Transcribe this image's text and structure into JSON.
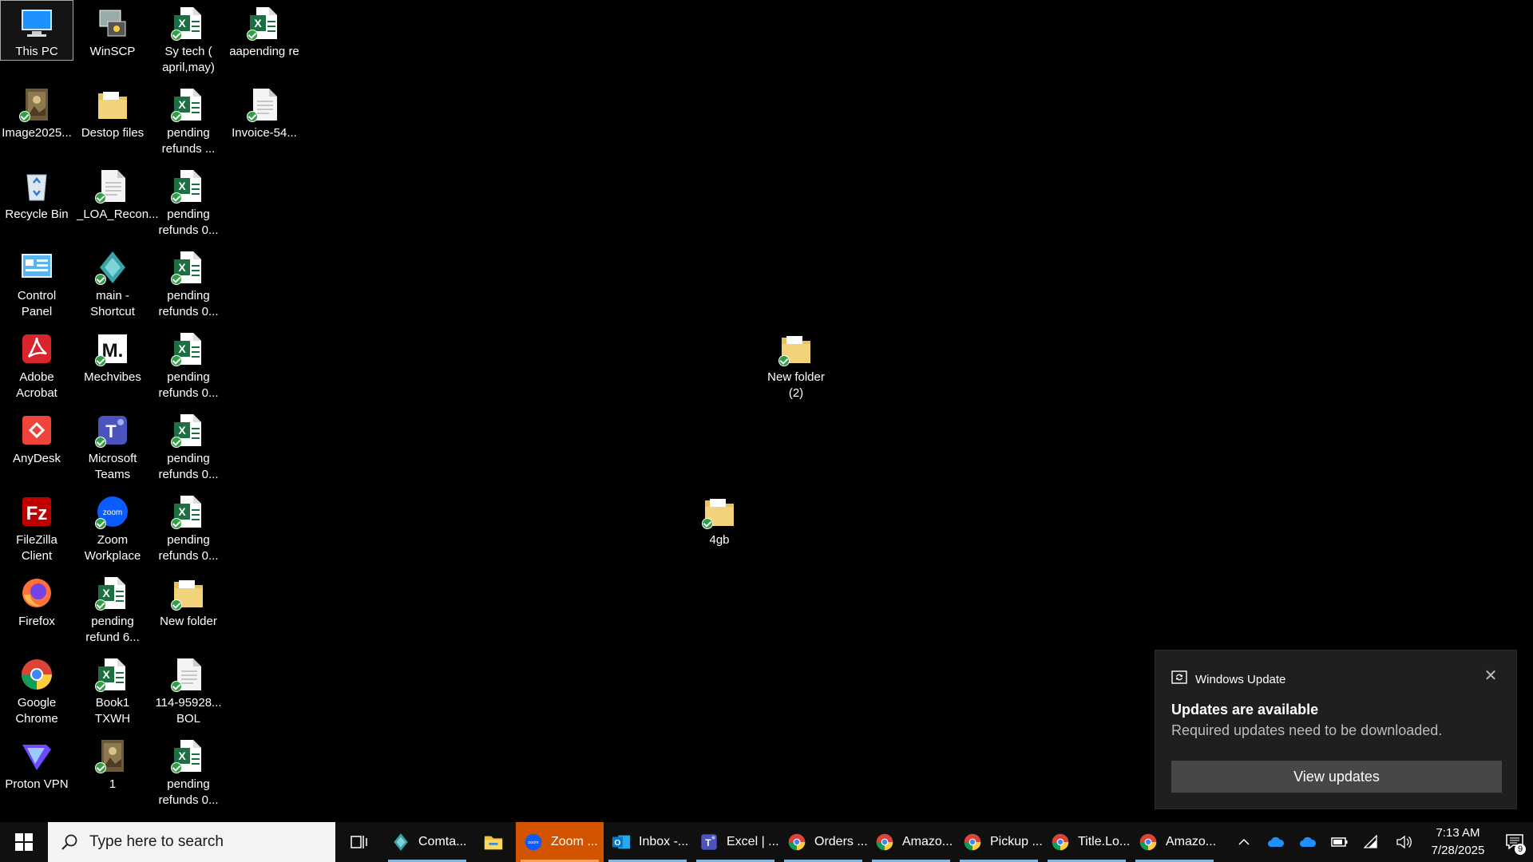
{
  "desktop": {
    "icons": [
      {
        "label": "This PC",
        "icon": "this-pc-icon",
        "col": 0,
        "row": 0,
        "selected": true,
        "synced": false
      },
      {
        "label": "WinSCP",
        "icon": "winscp-icon",
        "col": 1,
        "row": 0,
        "synced": false
      },
      {
        "label": "Sy tech (\napril,may)",
        "icon": "excel-file-icon",
        "col": 2,
        "row": 0,
        "synced": true
      },
      {
        "label": "aapending re",
        "icon": "excel-file-icon",
        "col": 3,
        "row": 0,
        "synced": true
      },
      {
        "label": "Image2025...",
        "icon": "image-file-icon",
        "col": 0,
        "row": 1,
        "synced": true
      },
      {
        "label": "Destop files",
        "icon": "folder-icon",
        "col": 1,
        "row": 1,
        "synced": false
      },
      {
        "label": "pending\nrefunds ...",
        "icon": "excel-file-icon",
        "col": 2,
        "row": 1,
        "synced": true
      },
      {
        "label": "Invoice-54...",
        "icon": "document-file-icon",
        "col": 3,
        "row": 1,
        "synced": true
      },
      {
        "label": "Recycle Bin",
        "icon": "recycle-bin-icon",
        "col": 0,
        "row": 2,
        "synced": false
      },
      {
        "label": "_LOA_Recon...",
        "icon": "document-file-icon",
        "col": 1,
        "row": 2,
        "synced": true
      },
      {
        "label": "pending\nrefunds 0...",
        "icon": "excel-file-icon",
        "col": 2,
        "row": 2,
        "synced": true
      },
      {
        "label": "Control Panel",
        "icon": "control-panel-icon",
        "col": 0,
        "row": 3,
        "synced": false
      },
      {
        "label": "main -\nShortcut",
        "icon": "shortcut-app-icon",
        "col": 1,
        "row": 3,
        "synced": true
      },
      {
        "label": "pending\nrefunds 0...",
        "icon": "excel-file-icon",
        "col": 2,
        "row": 3,
        "synced": true
      },
      {
        "label": "Adobe\nAcrobat",
        "icon": "adobe-acrobat-icon",
        "col": 0,
        "row": 4,
        "synced": false
      },
      {
        "label": "Mechvibes",
        "icon": "mechvibes-icon",
        "col": 1,
        "row": 4,
        "synced": true
      },
      {
        "label": "pending\nrefunds 0...",
        "icon": "excel-file-icon",
        "col": 2,
        "row": 4,
        "synced": true
      },
      {
        "label": "AnyDesk",
        "icon": "anydesk-icon",
        "col": 0,
        "row": 5,
        "synced": false
      },
      {
        "label": "Microsoft\nTeams",
        "icon": "teams-icon",
        "col": 1,
        "row": 5,
        "synced": true
      },
      {
        "label": "pending\nrefunds 0...",
        "icon": "excel-file-icon",
        "col": 2,
        "row": 5,
        "synced": true
      },
      {
        "label": "FileZilla\nClient",
        "icon": "filezilla-icon",
        "col": 0,
        "row": 6,
        "synced": false
      },
      {
        "label": "Zoom\nWorkplace",
        "icon": "zoom-icon",
        "col": 1,
        "row": 6,
        "synced": true
      },
      {
        "label": "pending\nrefunds 0...",
        "icon": "excel-file-icon",
        "col": 2,
        "row": 6,
        "synced": true
      },
      {
        "label": "Firefox",
        "icon": "firefox-icon",
        "col": 0,
        "row": 7,
        "synced": false
      },
      {
        "label": "pending\nrefund 6...",
        "icon": "excel-file-icon",
        "col": 1,
        "row": 7,
        "synced": true
      },
      {
        "label": "New folder",
        "icon": "folder-icon",
        "col": 2,
        "row": 7,
        "synced": true
      },
      {
        "label": "Google\nChrome",
        "icon": "chrome-icon",
        "col": 0,
        "row": 8,
        "synced": false
      },
      {
        "label": "Book1 TXWH",
        "icon": "excel-file-icon",
        "col": 1,
        "row": 8,
        "synced": true
      },
      {
        "label": "114-95928...\nBOL",
        "icon": "document-file-icon",
        "col": 2,
        "row": 8,
        "synced": true
      },
      {
        "label": "Proton VPN",
        "icon": "proton-vpn-icon",
        "col": 0,
        "row": 9,
        "synced": false
      },
      {
        "label": "1",
        "icon": "image-file-icon",
        "col": 1,
        "row": 9,
        "synced": true
      },
      {
        "label": "pending\nrefunds 0...",
        "icon": "excel-file-icon",
        "col": 2,
        "row": 9,
        "synced": true
      }
    ],
    "free_icons": [
      {
        "label": "New folder\n(2)",
        "icon": "folder-icon",
        "synced": true,
        "id": "nf2"
      },
      {
        "label": "4gb",
        "icon": "folder-icon",
        "synced": true,
        "id": "4gb"
      }
    ]
  },
  "toast": {
    "app_name": "Windows Update",
    "title": "Updates are available",
    "message": "Required updates need to be downloaded.",
    "button": "View updates",
    "close_glyph": "✕"
  },
  "taskbar": {
    "search_placeholder": "Type here to search",
    "apps": [
      {
        "label": "Comta...",
        "icon": "shortcut-app-icon",
        "running": true
      },
      {
        "label": "",
        "icon": "file-explorer-icon",
        "running": false,
        "fe": true
      },
      {
        "label": "Zoom ...",
        "icon": "zoom-icon",
        "running": true,
        "active": true
      },
      {
        "label": "Inbox -...",
        "icon": "outlook-icon",
        "running": true
      },
      {
        "label": "Excel | ...",
        "icon": "teams-icon",
        "running": true
      },
      {
        "label": "Orders ...",
        "icon": "chrome-icon",
        "running": true
      },
      {
        "label": "Amazo...",
        "icon": "chrome-icon",
        "running": true
      },
      {
        "label": "Pickup ...",
        "icon": "chrome-icon",
        "running": true
      },
      {
        "label": "Title.Lo...",
        "icon": "chrome-icon",
        "running": true
      },
      {
        "label": "Amazo...",
        "icon": "chrome-icon",
        "running": true
      }
    ],
    "tray_icons": [
      "chevron-up-icon",
      "onedrive-icon",
      "onedrive-icon",
      "battery-icon",
      "wifi-icon",
      "volume-icon"
    ],
    "time": "7:13 AM",
    "date": "7/28/2025",
    "notification_count": "9"
  },
  "colors": {
    "accent": "#d35400",
    "excel": "#1d6f42",
    "sync": "#2ea043"
  }
}
